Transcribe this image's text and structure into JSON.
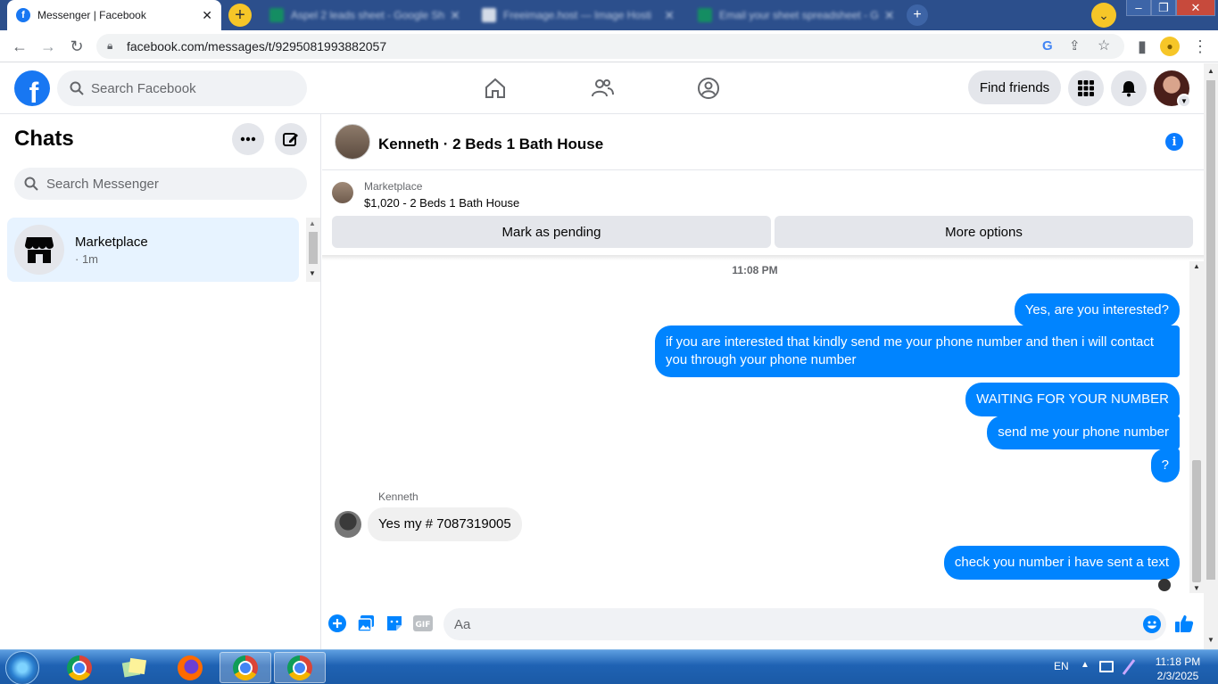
{
  "browser": {
    "tabs": [
      {
        "title": "Messenger | Facebook",
        "active": true
      },
      {
        "title": "Aspel 2 leads sheet - Google Sh",
        "active": false
      },
      {
        "title": "Freeimage.host — Image Hosti",
        "active": false
      },
      {
        "title": "Email your sheet spreadsheet - G",
        "active": false
      }
    ],
    "url": "facebook.com/messages/t/9295081993882057"
  },
  "fb": {
    "search_placeholder": "Search Facebook",
    "find_friends": "Find friends"
  },
  "sidebar": {
    "title": "Chats",
    "search_placeholder": "Search Messenger",
    "chats": [
      {
        "name": "Marketplace",
        "time": "· 1m"
      }
    ]
  },
  "conversation": {
    "title": "Kenneth · 2 Beds 1 Bath House",
    "listing_source": "Marketplace",
    "listing": "$1,020 - 2 Beds 1 Bath House",
    "mark_pending": "Mark as pending",
    "more_options": "More options",
    "timestamp": "11:08 PM",
    "sender_name": "Kenneth",
    "messages": [
      {
        "text": "Yes, are you interested?",
        "from": "me"
      },
      {
        "text": "if you are interested that kindly send me your phone number and then i will contact you through your phone number",
        "from": "me"
      },
      {
        "text": "WAITING FOR YOUR NUMBER",
        "from": "me"
      },
      {
        "text": "send me your phone number",
        "from": "me"
      },
      {
        "text": "?",
        "from": "me"
      },
      {
        "text": "Yes my # 7087319005",
        "from": "Kenneth"
      },
      {
        "text": "check you number i have sent a text",
        "from": "me"
      }
    ],
    "input_placeholder": "Aa"
  },
  "taskbar": {
    "language": "EN",
    "time": "11:18 PM",
    "date": "2/3/2025"
  },
  "colors": {
    "accent": "#0084ff",
    "fb_blue": "#1877f2"
  }
}
